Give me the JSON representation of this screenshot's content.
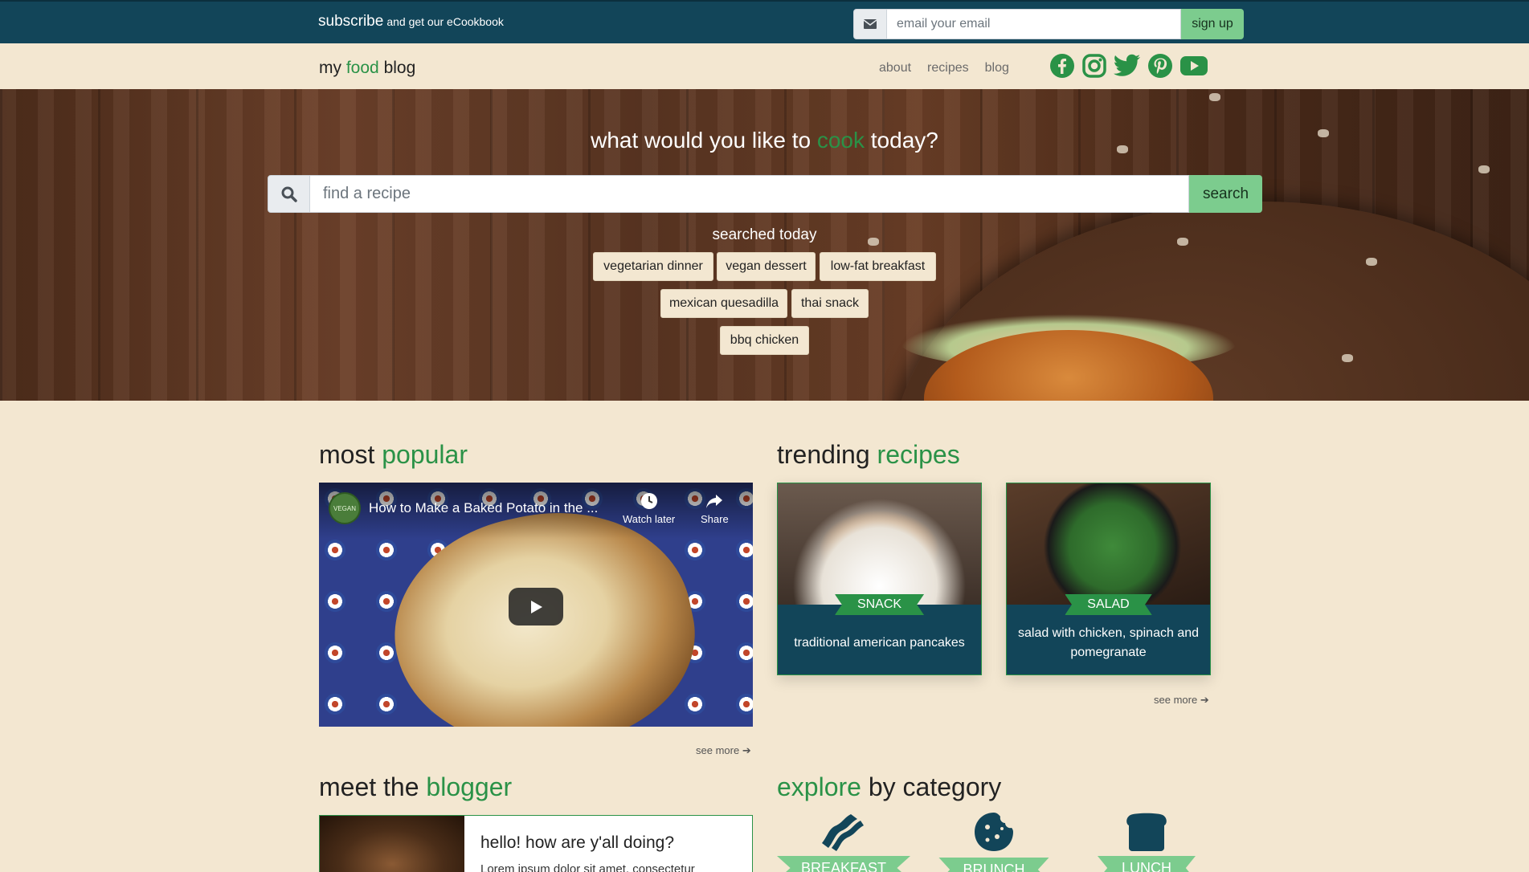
{
  "subscribe": {
    "title": "subscribe",
    "subtitle": "and get our eCookbook",
    "email_placeholder": "email your email",
    "button": "sign up"
  },
  "nav": {
    "brand_prefix": "my",
    "brand_accent": "food",
    "brand_suffix": "blog",
    "links": [
      "about",
      "recipes",
      "blog"
    ],
    "socials": [
      "facebook-icon",
      "instagram-icon",
      "twitter-icon",
      "pinterest-icon",
      "youtube-icon"
    ]
  },
  "hero": {
    "title_prefix": "what would you like to",
    "title_accent": "cook",
    "title_suffix": "today?",
    "search_placeholder": "find a recipe",
    "search_button": "search",
    "searched_label": "searched today",
    "chips": [
      "vegetarian dinner",
      "vegan dessert",
      "low-fat breakfast",
      "mexican quesadilla",
      "thai snack",
      "bbq chicken"
    ]
  },
  "popular": {
    "title_prefix": "most",
    "title_accent": "popular",
    "video_title": "How to Make a Baked Potato in the ...",
    "channel_badge": "VEGAN",
    "watch_later": "Watch later",
    "share": "Share",
    "see_more": "see more"
  },
  "trending": {
    "title_prefix": "trending",
    "title_accent": "recipes",
    "cards": [
      {
        "category": "SNACK",
        "title": "traditional american pancakes"
      },
      {
        "category": "SALAD",
        "title": "salad with chicken, spinach and pomegranate"
      }
    ],
    "see_more": "see more"
  },
  "blogger": {
    "title_prefix": "meet the",
    "title_accent": "blogger",
    "greeting": "hello! how are y'all doing?",
    "text": "Lorem ipsum dolor sit amet, consectetur"
  },
  "categories": {
    "title_accent": "explore",
    "title_suffix": "by category",
    "items": [
      "BREAKFAST",
      "BRUNCH",
      "LUNCH"
    ]
  },
  "colors": {
    "primary": "#124559",
    "accent": "#2a9247",
    "button": "#7ccc8e",
    "background": "#f3e7d1"
  }
}
